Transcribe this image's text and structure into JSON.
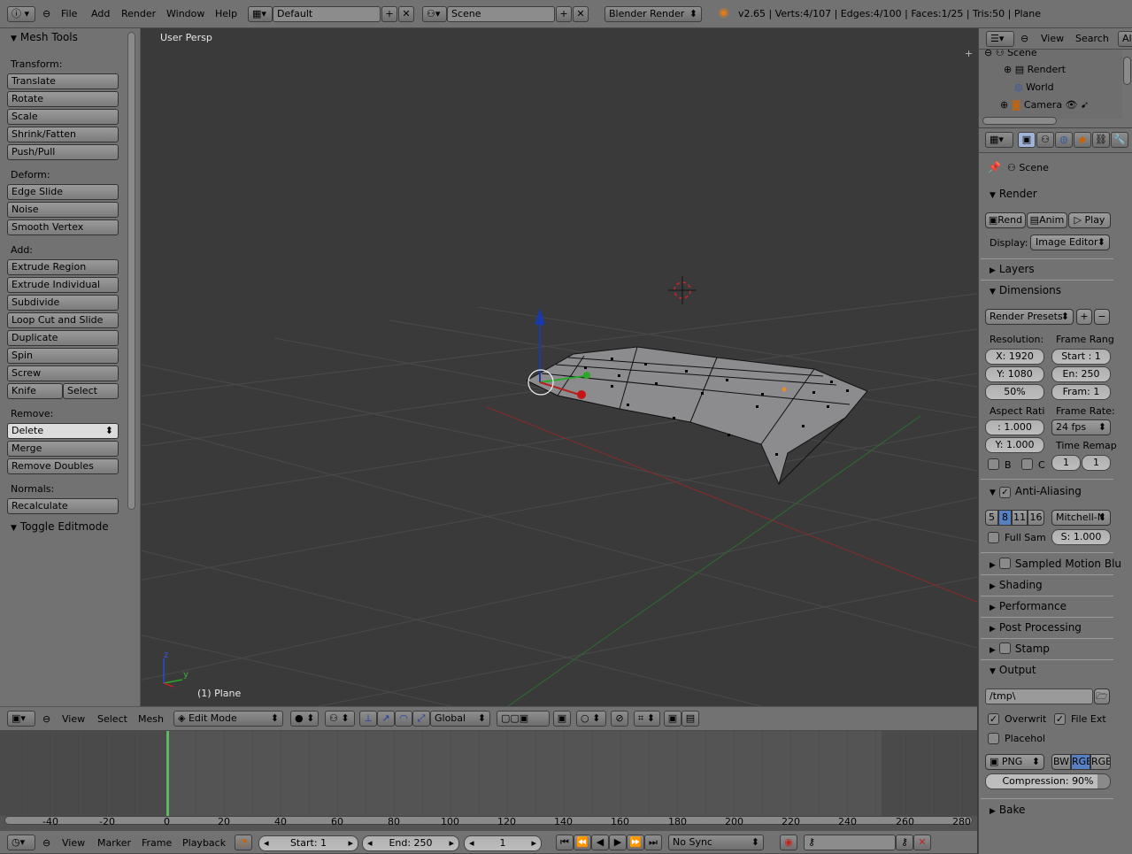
{
  "info_header": {
    "menus": [
      "File",
      "Add",
      "Render",
      "Window",
      "Help"
    ],
    "screen_layout": "Default",
    "scene": "Scene",
    "render_engine": "Blender Render",
    "stats": "v2.65 | Verts:4/107 | Edges:4/100 | Faces:1/25 | Tris:50 | Plane"
  },
  "tool_shelf": {
    "title": "Mesh Tools",
    "transform_label": "Transform:",
    "transform": [
      "Translate",
      "Rotate",
      "Scale",
      "Shrink/Fatten",
      "Push/Pull"
    ],
    "deform_label": "Deform:",
    "deform": [
      "Edge Slide",
      "Noise",
      "Smooth Vertex"
    ],
    "add_label": "Add:",
    "add": [
      "Extrude Region",
      "Extrude Individual",
      "Subdivide",
      "Loop Cut and Slide",
      "Duplicate",
      "Spin",
      "Screw"
    ],
    "knife": "Knife",
    "select": "Select",
    "remove_label": "Remove:",
    "delete": "Delete",
    "remove": [
      "Merge",
      "Remove Doubles"
    ],
    "normals_label": "Normals:",
    "recalculate": "Recalculate",
    "toggle_editmode": "Toggle Editmode"
  },
  "viewport": {
    "view_name": "User Persp",
    "object_label": "(1) Plane",
    "axis_x": "x",
    "axis_y": "y",
    "axis_z": "z"
  },
  "view3d_header": {
    "menus": [
      "View",
      "Select",
      "Mesh"
    ],
    "mode": "Edit Mode",
    "orientation": "Global"
  },
  "outliner": {
    "menus": [
      "View",
      "Search"
    ],
    "filter": "All",
    "items": [
      "Scene",
      "Rendert",
      "World",
      "Camera"
    ]
  },
  "properties": {
    "context": "Scene",
    "render_panel": "Render",
    "render_btn": "Rend",
    "anim_btn": "Anim",
    "play_btn": "Play",
    "display_label": "Display:",
    "display_value": "Image Editor",
    "layers": "Layers",
    "dimensions": "Dimensions",
    "render_presets": "Render Presets",
    "resolution_label": "Resolution:",
    "res_x": "X: 1920",
    "res_y": "Y: 1080",
    "res_pct": "50%",
    "frame_range_label": "Frame Rang",
    "frame_start": "Start : 1",
    "frame_end": "En: 250",
    "frame_step": "Fram: 1",
    "aspect_label": "Aspect Rati",
    "aspect_x": ": 1.000",
    "aspect_y": "Y: 1.000",
    "frame_rate_label": "Frame Rate:",
    "frame_rate": "24 fps",
    "time_remap_label": "Time Remap",
    "remap_old": "1",
    "remap_new": "1",
    "border_b": "B",
    "border_c": "C",
    "aa": "Anti-Aliasing",
    "aa_samples": [
      "5",
      "8",
      "11",
      "16"
    ],
    "aa_filter": "Mitchell-N",
    "full_sample": "Full Sam",
    "filter_size": "S: 1.000",
    "sampled_motion": "Sampled Motion Blu",
    "shading": "Shading",
    "performance": "Performance",
    "post_processing": "Post Processing",
    "stamp": "Stamp",
    "output": "Output",
    "output_path": "/tmp\\",
    "overwrite": "Overwrit",
    "file_ext": "File Ext",
    "placeholder": "Placehol",
    "format": "PNG",
    "color_modes": [
      "BW",
      "RGB",
      "RGB"
    ],
    "compression": "Compression: 90%",
    "bake": "Bake"
  },
  "timeline": {
    "ticks": [
      "-40",
      "-20",
      "0",
      "20",
      "40",
      "60",
      "80",
      "100",
      "120",
      "140",
      "160",
      "180",
      "200",
      "220",
      "240",
      "260",
      "280"
    ],
    "menus": [
      "View",
      "Marker",
      "Frame",
      "Playback"
    ],
    "start": "Start: 1",
    "end": "End: 250",
    "current": "1",
    "sync": "No Sync"
  },
  "colors": {
    "viewport_bg": "#3a3a3a",
    "header_bg": "#727272",
    "panel_bg": "#727272",
    "selected_blue": "#5680c2",
    "axis_red": "#b03030",
    "axis_green": "#2e8a2e"
  }
}
